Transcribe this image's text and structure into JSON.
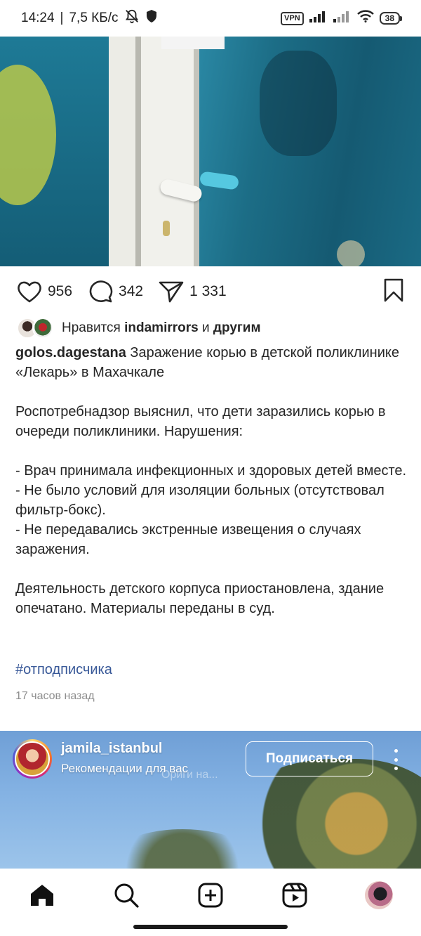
{
  "status_bar": {
    "time": "14:24",
    "separator": "|",
    "speed": "7,5 КБ/с",
    "vpn": "VPN",
    "battery": "38"
  },
  "post": {
    "likes_count": "956",
    "comments_count": "342",
    "shares_count": "1 331",
    "likes_prefix": "Нравится",
    "liked_by": "indamirrors",
    "likes_conjunction": "и",
    "likes_others": "другим",
    "author": "golos.dagestana",
    "caption": "Заражение корью в детской поликлинике «Лекарь» в Махачкале\n\nРоспотребнадзор выяснил, что дети заразились корью в очереди поликлиники. Нарушения:\n\n- Врач принимала инфекционных и здоровых детей вместе.\n- Не было условий для изоляции больных (отсутствовал фильтр-бокс).\n- Не передавались экстренные извещения о случаях заражения.\n\nДеятельность детского корпуса приостановлена, здание опечатано. Материалы переданы в суд.",
    "hashtag": "#отподписчика",
    "time_ago": "17 часов назад"
  },
  "next_post": {
    "username": "jamila_istanbul",
    "subtitle": "Рекомендации для вас",
    "ghost_text": "Ориги на...",
    "follow_label": "Подписаться"
  },
  "icons": {
    "like": "heart-icon",
    "comment": "comment-icon",
    "share": "send-icon",
    "save": "bookmark-icon",
    "nav": [
      "home-icon",
      "search-icon",
      "create-icon",
      "reels-icon",
      "profile-avatar"
    ]
  },
  "colors": {
    "text": "#262626",
    "link": "#385898",
    "muted": "#8e8e8e"
  }
}
